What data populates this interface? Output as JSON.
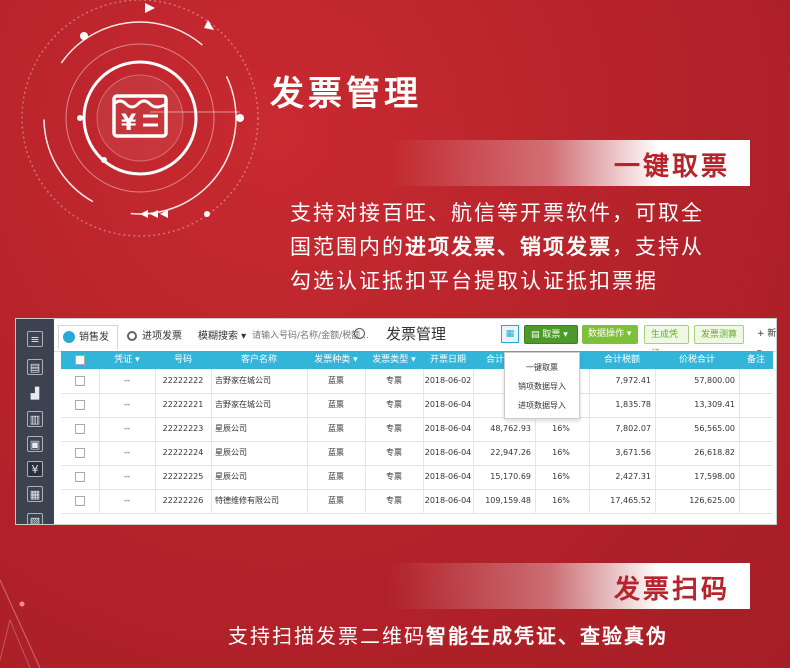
{
  "hero": {
    "title": "发票管理",
    "icon_symbol": "¥",
    "accent_color": "#b8222a"
  },
  "section1": {
    "banner": "一键取票",
    "desc_line1": "支持对接百旺、航信等开票软件，可取全",
    "desc_line2_a": "国范围内的",
    "desc_line2_b": "进项发票、销项发票",
    "desc_line2_c": "，支持从",
    "desc_line3": "勾选认证抵扣平台提取认证抵扣票据"
  },
  "app": {
    "tabs": [
      {
        "label": "销售发票",
        "active": true
      },
      {
        "label": "进项发票",
        "active": false
      }
    ],
    "fuzzy_search": "模糊搜索",
    "search_placeholder": "请输入号码/名称/金额/税额...",
    "page_title": "发票管理",
    "buttons": {
      "take": "取票",
      "data_ops": "数据操作",
      "gen_voucher": "生成凭证",
      "check": "发票测算",
      "add": "+ 新增"
    },
    "dropdown": [
      "一键取票",
      "销项数据导入",
      "进项数据导入"
    ],
    "columns": [
      "凭证",
      "号码",
      "客户名称",
      "发票种类",
      "发票类型",
      "开票日期",
      "合计金额",
      "",
      "合计税额",
      "价税合计",
      "备注"
    ],
    "rows": [
      {
        "voucher": "--",
        "number": "22222222",
        "customer": "吉野家在城公司",
        "kind": "蓝票",
        "type": "专票",
        "date": "2018-06-02",
        "amount": "49,8",
        "rate": "",
        "tax": "7,972.41",
        "total": "57,800.00"
      },
      {
        "voucher": "--",
        "number": "22222221",
        "customer": "吉野家在城公司",
        "kind": "蓝票",
        "type": "专票",
        "date": "2018-06-04",
        "amount": "11,4",
        "rate": "",
        "tax": "1,835.78",
        "total": "13,309.41"
      },
      {
        "voucher": "--",
        "number": "22222223",
        "customer": "星辰公司",
        "kind": "蓝票",
        "type": "专票",
        "date": "2018-06-04",
        "amount": "48,762.93",
        "rate": "16%",
        "tax": "7,802.07",
        "total": "56,565.00"
      },
      {
        "voucher": "--",
        "number": "22222224",
        "customer": "星辰公司",
        "kind": "蓝票",
        "type": "专票",
        "date": "2018-06-04",
        "amount": "22,947.26",
        "rate": "16%",
        "tax": "3,671.56",
        "total": "26,618.82"
      },
      {
        "voucher": "--",
        "number": "22222225",
        "customer": "星辰公司",
        "kind": "蓝票",
        "type": "专票",
        "date": "2018-06-04",
        "amount": "15,170.69",
        "rate": "16%",
        "tax": "2,427.31",
        "total": "17,598.00"
      },
      {
        "voucher": "--",
        "number": "22222226",
        "customer": "特德维修有限公司",
        "kind": "蓝票",
        "type": "专票",
        "date": "2018-06-04",
        "amount": "109,159.48",
        "rate": "16%",
        "tax": "17,465.52",
        "total": "126,625.00"
      }
    ]
  },
  "section2": {
    "banner": "发票扫码",
    "desc_a": "支持扫描发票二维码",
    "desc_b": "智能生成凭证、查验真伪"
  }
}
